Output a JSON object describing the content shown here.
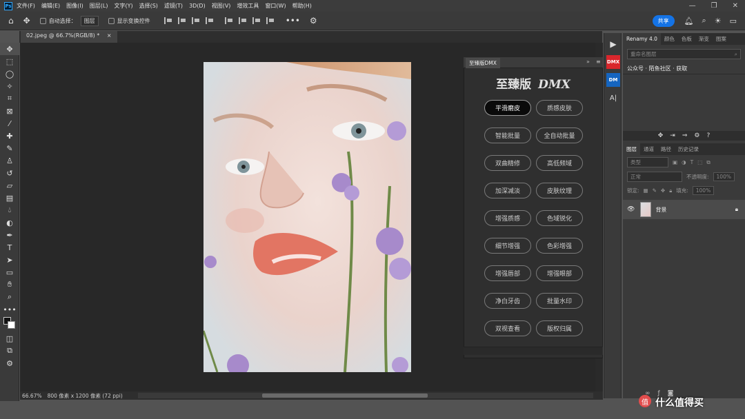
{
  "menubar": {
    "logo": "Ps",
    "items": [
      "文件(F)",
      "编辑(E)",
      "图像(I)",
      "图层(L)",
      "文字(Y)",
      "选择(S)",
      "滤镜(T)",
      "3D(D)",
      "视图(V)",
      "增效工具",
      "窗口(W)",
      "帮助(H)"
    ],
    "window_controls": [
      "—",
      "❐",
      "✕"
    ]
  },
  "options": {
    "auto_select_label": "自动选择：",
    "auto_select_value": "图层",
    "show_transform_label": "显示变换控件",
    "share_label": "共享"
  },
  "document": {
    "tab_title": "02.jpeg @ 66.7%(RGB/8) *",
    "tab_close": "×",
    "zoom": "66.67%",
    "doc_info": "800 像素 x 1200 像素 (72 ppi)"
  },
  "dmx_panel": {
    "tab": "至臻版DMX",
    "title_cn": "至臻版",
    "title_en": "DMX",
    "buttons": [
      [
        "平滑磨皮",
        "质感皮肤"
      ],
      [
        "智能批量",
        "全自动批量"
      ],
      [
        "双曲精修",
        "高低频域"
      ],
      [
        "加深减淡",
        "皮肤纹理"
      ],
      [
        "增强质感",
        "色域锐化"
      ],
      [
        "细节增强",
        "色彩增强"
      ],
      [
        "增强唇部",
        "增强眼部"
      ],
      [
        "净白牙齿",
        "批量水印"
      ],
      [
        "双视查看",
        "版权归属"
      ]
    ],
    "active_button": "平滑磨皮"
  },
  "icon_strip": [
    "▶",
    "DMX",
    "DM",
    "A|"
  ],
  "right_panel": {
    "top_tabs": [
      "Renamy 4.0",
      "颜色",
      "色板",
      "渐变",
      "图案"
    ],
    "search_placeholder": "重命名图层",
    "link_line": "公众号 · 陌鱼社区 · 获取",
    "layer_tabs": [
      "图层",
      "通道",
      "路径",
      "历史记录"
    ],
    "kind_label": "类型",
    "blend_mode": "正常",
    "opacity_label": "不透明度:",
    "opacity_value": "100%",
    "lock_label": "锁定:",
    "fill_label": "填充:",
    "fill_value": "100%",
    "layer_name": "背景"
  },
  "watermark": {
    "logo": "值",
    "text": "什么值得买"
  },
  "colors": {
    "accent": "#1473e6",
    "dmx_red": "#d9262c",
    "dm_blue": "#1565c0"
  }
}
